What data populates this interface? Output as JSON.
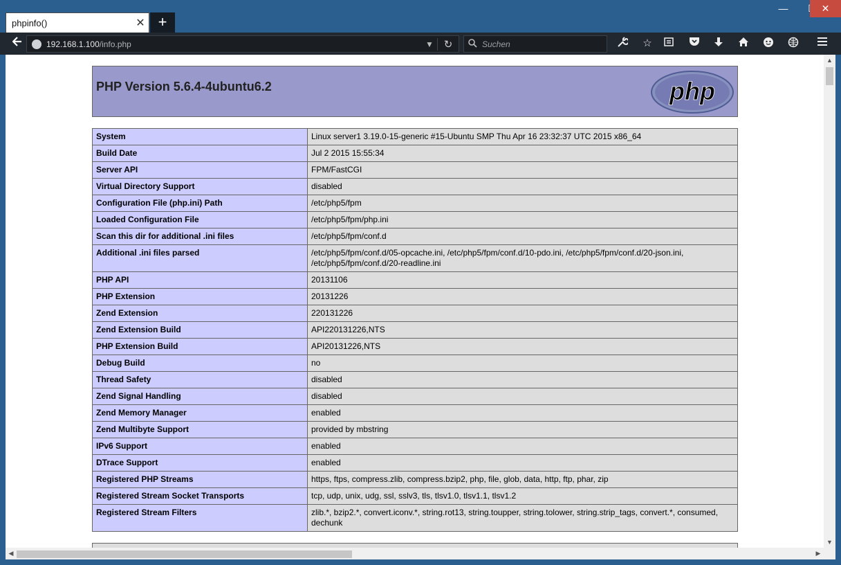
{
  "browser": {
    "tab_title": "phpinfo()",
    "url_host": "192.168.1.100",
    "url_path": "/info.php",
    "search_placeholder": "Suchen"
  },
  "page": {
    "heading": "PHP Version 5.6.4-4ubuntu6.2",
    "logo_text": "php",
    "colors": {
      "header": "#9999cc",
      "key_cell": "#ccccff",
      "value_cell": "#dddddd"
    },
    "rows": [
      {
        "key": "System",
        "value": "Linux server1 3.19.0-15-generic #15-Ubuntu SMP Thu Apr 16 23:32:37 UTC 2015 x86_64"
      },
      {
        "key": "Build Date",
        "value": "Jul 2 2015 15:55:34"
      },
      {
        "key": "Server API",
        "value": "FPM/FastCGI"
      },
      {
        "key": "Virtual Directory Support",
        "value": "disabled"
      },
      {
        "key": "Configuration File (php.ini) Path",
        "value": "/etc/php5/fpm"
      },
      {
        "key": "Loaded Configuration File",
        "value": "/etc/php5/fpm/php.ini"
      },
      {
        "key": "Scan this dir for additional .ini files",
        "value": "/etc/php5/fpm/conf.d"
      },
      {
        "key": "Additional .ini files parsed",
        "value": "/etc/php5/fpm/conf.d/05-opcache.ini, /etc/php5/fpm/conf.d/10-pdo.ini, /etc/php5/fpm/conf.d/20-json.ini, /etc/php5/fpm/conf.d/20-readline.ini"
      },
      {
        "key": "PHP API",
        "value": "20131106"
      },
      {
        "key": "PHP Extension",
        "value": "20131226"
      },
      {
        "key": "Zend Extension",
        "value": "220131226"
      },
      {
        "key": "Zend Extension Build",
        "value": "API220131226,NTS"
      },
      {
        "key": "PHP Extension Build",
        "value": "API20131226,NTS"
      },
      {
        "key": "Debug Build",
        "value": "no"
      },
      {
        "key": "Thread Safety",
        "value": "disabled"
      },
      {
        "key": "Zend Signal Handling",
        "value": "disabled"
      },
      {
        "key": "Zend Memory Manager",
        "value": "enabled"
      },
      {
        "key": "Zend Multibyte Support",
        "value": "provided by mbstring"
      },
      {
        "key": "IPv6 Support",
        "value": "enabled"
      },
      {
        "key": "DTrace Support",
        "value": "enabled"
      },
      {
        "key": "Registered PHP Streams",
        "value": "https, ftps, compress.zlib, compress.bzip2, php, file, glob, data, http, ftp, phar, zip"
      },
      {
        "key": "Registered Stream Socket Transports",
        "value": "tcp, udp, unix, udg, ssl, sslv3, tls, tlsv1.0, tlsv1.1, tlsv1.2"
      },
      {
        "key": "Registered Stream Filters",
        "value": "zlib.*, bzip2.*, convert.iconv.*, string.rot13, string.toupper, string.tolower, string.strip_tags, convert.*, consumed, dechunk"
      }
    ]
  },
  "toolbar_icons": [
    "wrench-icon",
    "bookmark-star-icon",
    "reading-list-icon",
    "pocket-icon",
    "download-icon",
    "home-icon",
    "chat-icon",
    "web-icon",
    "menu-icon"
  ]
}
